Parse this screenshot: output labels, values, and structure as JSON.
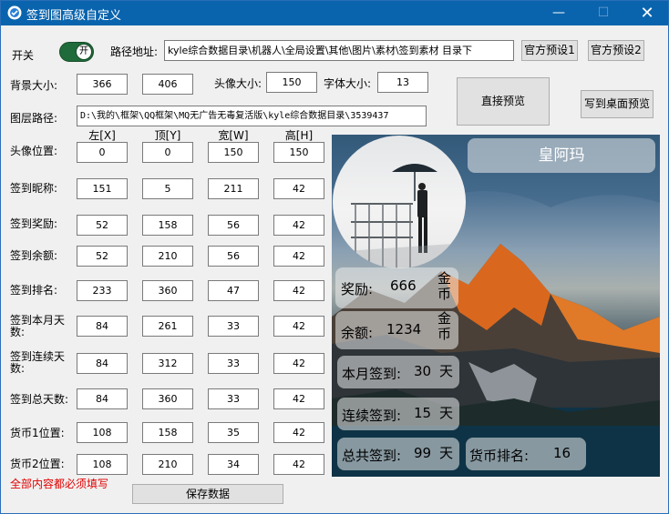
{
  "window": {
    "title": "签到图高级自定义",
    "min_icon": "minimize-icon",
    "max_icon": "maximize-icon",
    "close_icon": "close-icon"
  },
  "switch": {
    "label": "开关",
    "state": "开",
    "on": true
  },
  "path": {
    "label": "路径地址:",
    "value": "kyle综合数据目录\\机器人\\全局设置\\其他\\图片\\素材\\签到素材 目录下"
  },
  "presets": {
    "preset1": "官方预设1",
    "preset2": "官方预设2"
  },
  "bg_size": {
    "label": "背景大小:",
    "width": "366",
    "height": "406"
  },
  "avatar_size": {
    "label": "头像大小:",
    "value": "150"
  },
  "font_size": {
    "label": "字体大小:",
    "value": "13"
  },
  "buttons": {
    "direct_preview": "直接预览",
    "desktop_preview": "写到桌面预览",
    "save": "保存数据"
  },
  "layer_path": {
    "label": "图层路径:",
    "value": "D:\\我的\\框架\\QQ框架\\MQ无广告无毒复活版\\kyle综合数据目录\\3539437"
  },
  "columns": [
    "左[X]",
    "顶[Y]",
    "宽[W]",
    "高[H]"
  ],
  "rows": [
    {
      "label": "头像位置:",
      "values": [
        "0",
        "0",
        "150",
        "150"
      ]
    },
    {
      "label": "签到昵称:",
      "values": [
        "151",
        "5",
        "211",
        "42"
      ]
    },
    {
      "label": "签到奖励:",
      "values": [
        "52",
        "158",
        "56",
        "42"
      ]
    },
    {
      "label": "签到余额:",
      "values": [
        "52",
        "210",
        "56",
        "42"
      ]
    },
    {
      "label": "签到排名:",
      "values": [
        "233",
        "360",
        "47",
        "42"
      ]
    },
    {
      "label": "签到本月天数:",
      "values": [
        "84",
        "261",
        "33",
        "42"
      ]
    },
    {
      "label": "签到连续天数:",
      "values": [
        "84",
        "312",
        "33",
        "42"
      ]
    },
    {
      "label": "签到总天数:",
      "values": [
        "84",
        "360",
        "33",
        "42"
      ]
    },
    {
      "label": "货币1位置:",
      "values": [
        "108",
        "158",
        "35",
        "42"
      ]
    },
    {
      "label": "货币2位置:",
      "values": [
        "108",
        "210",
        "34",
        "42"
      ]
    }
  ],
  "note": "全部内容都必须填写",
  "preview": {
    "nickname": "皇阿玛",
    "reward": {
      "label": "奖励:",
      "value": "666",
      "unit": "金币"
    },
    "balance": {
      "label": "余额:",
      "value": "1234",
      "unit": "金币"
    },
    "month_days": {
      "label": "本月签到:",
      "value": "30",
      "unit": "天"
    },
    "streak_days": {
      "label": "连续签到:",
      "value": "15",
      "unit": "天"
    },
    "total_days": {
      "label": "总共签到:",
      "value": "99",
      "unit": "天"
    },
    "rank": {
      "label": "货币排名:",
      "value": "16"
    }
  }
}
